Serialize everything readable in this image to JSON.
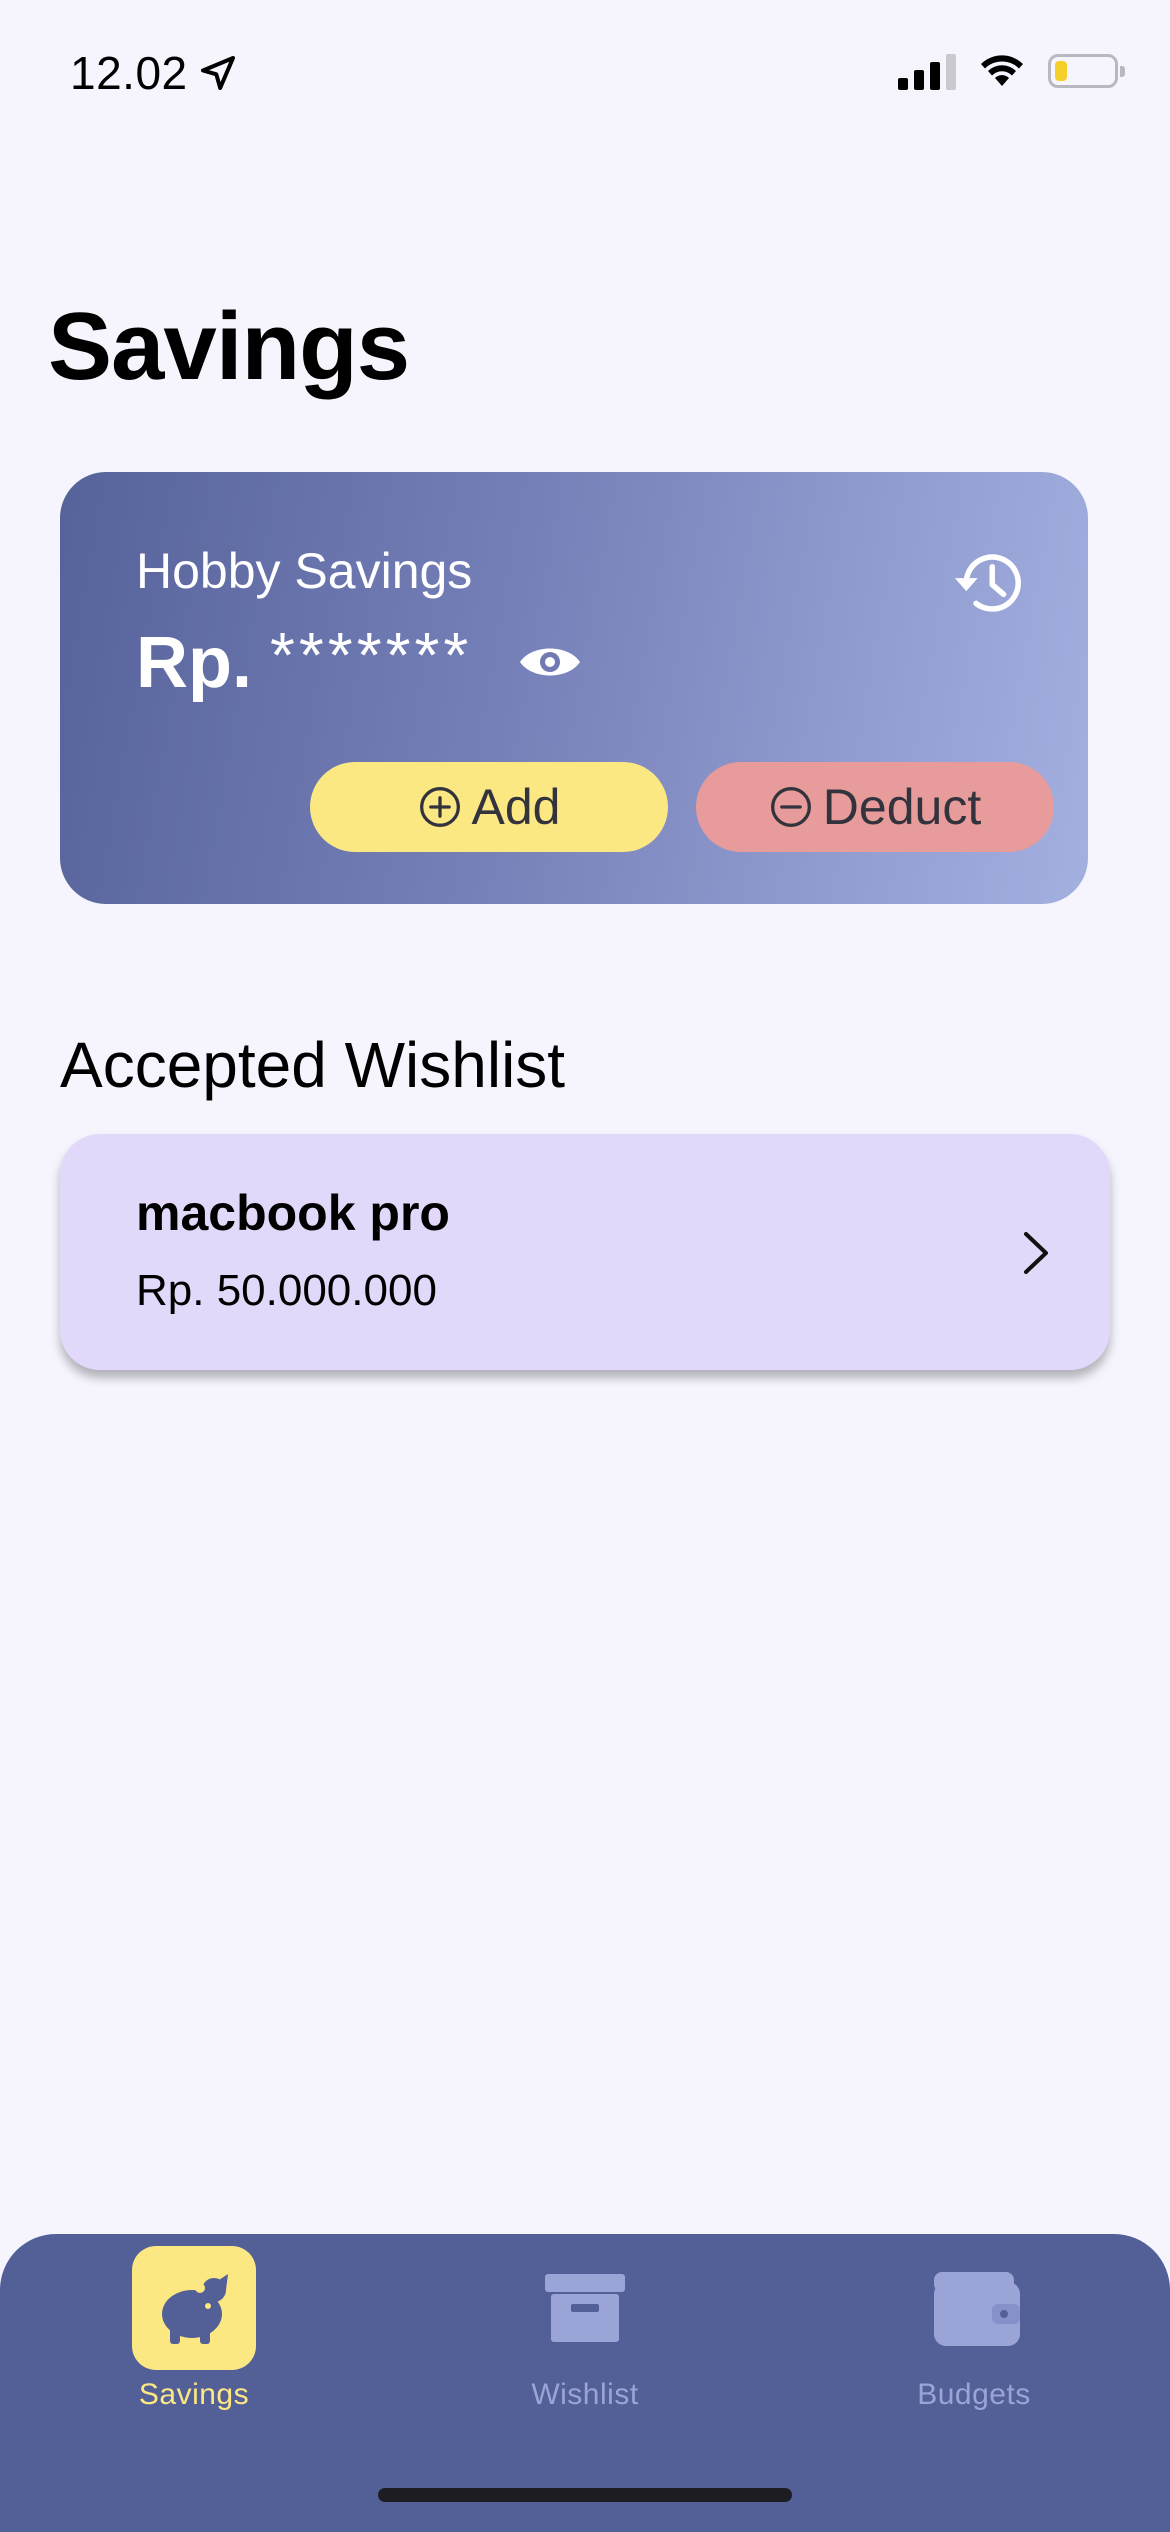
{
  "status_bar": {
    "time": "12.02"
  },
  "page": {
    "title": "Savings"
  },
  "savings_card": {
    "label": "Hobby Savings",
    "currency": "Rp.",
    "masked_amount": "*******",
    "add_label": "Add",
    "deduct_label": "Deduct",
    "gradient_start": "#56629a",
    "gradient_end": "#a4b0e0"
  },
  "wishlist": {
    "section_title": "Accepted Wishlist",
    "items": [
      {
        "name": "macbook pro",
        "price": "Rp. 50.000.000"
      }
    ]
  },
  "tabbar": {
    "active": "Savings",
    "tabs": [
      {
        "label": "Savings",
        "icon": "piggy-bank-icon"
      },
      {
        "label": "Wishlist",
        "icon": "archive-box-icon"
      },
      {
        "label": "Budgets",
        "icon": "wallet-icon"
      }
    ]
  },
  "colors": {
    "background": "#f6f5fe",
    "accent_yellow": "#fce883",
    "deduct_red": "#e79c9b",
    "tabbar": "#535f97",
    "wish_card": "#e2d9fa"
  }
}
